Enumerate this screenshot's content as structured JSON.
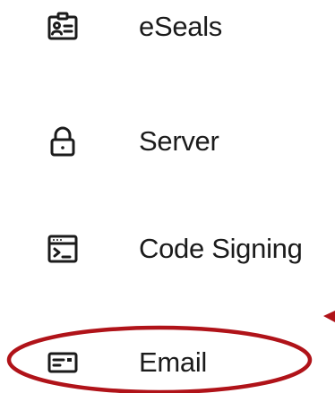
{
  "menu": {
    "items": [
      {
        "label": "eSeals",
        "icon": "id-badge-icon"
      },
      {
        "label": "Server",
        "icon": "lock-icon"
      },
      {
        "label": "Code Signing",
        "icon": "terminal-window-icon"
      },
      {
        "label": "Email",
        "icon": "email-card-icon"
      }
    ]
  },
  "colors": {
    "text": "#1b1b1b",
    "icon": "#1b1b1b",
    "annotation": "#b01319"
  }
}
